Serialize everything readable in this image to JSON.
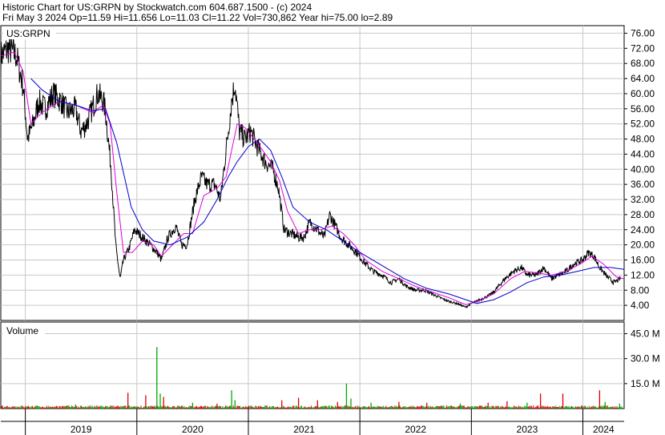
{
  "header": {
    "line1": "Historic Chart for US:GRPN by Stockwatch.com 604.687.1500 - (c) 2024",
    "line2": "Fri May  3 2024  Op=11.59  Hi=11.656  Lo=11.03  Cl=11.22  Vol=730,862  Year hi=75.00  lo=2.89"
  },
  "colors": {
    "background": "#ffffff",
    "grid": "#c8c8c8",
    "price": "#000000",
    "ma_short": "#e000e0",
    "ma_long": "#0000cc",
    "volume_up": "#00aa00",
    "volume_down": "#dd0000"
  },
  "chart_data": [
    {
      "type": "line",
      "panel_label": "US:GRPN",
      "y_ticks": [
        4,
        8,
        12,
        16,
        20,
        24,
        28,
        32,
        36,
        40,
        44,
        48,
        52,
        56,
        60,
        64,
        68,
        72,
        76
      ],
      "y_tick_labels": [
        "4.00",
        "8.00",
        "12.00",
        "16.00",
        "20.00",
        "24.00",
        "28.00",
        "32.00",
        "36.00",
        "40.00",
        "44.00",
        "48.00",
        "52.00",
        "56.00",
        "60.00",
        "64.00",
        "68.00",
        "72.00",
        "76.00"
      ],
      "ylim": [
        0,
        78
      ],
      "xlim": [
        2018.78,
        2024.37
      ],
      "x_year_labels": [
        "2019",
        "2020",
        "2021",
        "2022",
        "2023",
        "2024"
      ],
      "x_year_starts": [
        2019,
        2020,
        2021,
        2022,
        2023,
        2024
      ],
      "grid": true,
      "series": [
        {
          "name": "price",
          "points": [
            [
              2018.78,
              70
            ],
            [
              2018.85,
              72
            ],
            [
              2018.92,
              70
            ],
            [
              2018.98,
              62
            ],
            [
              2019.02,
              48
            ],
            [
              2019.07,
              52
            ],
            [
              2019.12,
              58
            ],
            [
              2019.18,
              56
            ],
            [
              2019.25,
              60
            ],
            [
              2019.32,
              58
            ],
            [
              2019.38,
              55
            ],
            [
              2019.45,
              56
            ],
            [
              2019.5,
              50
            ],
            [
              2019.55,
              52
            ],
            [
              2019.6,
              56
            ],
            [
              2019.65,
              60
            ],
            [
              2019.7,
              58
            ],
            [
              2019.72,
              55
            ],
            [
              2019.77,
              40
            ],
            [
              2019.81,
              20
            ],
            [
              2019.85,
              11
            ],
            [
              2019.88,
              16
            ],
            [
              2019.93,
              19
            ],
            [
              2019.98,
              24
            ],
            [
              2020.05,
              22
            ],
            [
              2020.12,
              20
            ],
            [
              2020.18,
              18
            ],
            [
              2020.22,
              16
            ],
            [
              2020.28,
              22
            ],
            [
              2020.35,
              25
            ],
            [
              2020.4,
              20
            ],
            [
              2020.45,
              20
            ],
            [
              2020.52,
              32
            ],
            [
              2020.58,
              38
            ],
            [
              2020.63,
              36
            ],
            [
              2020.7,
              36
            ],
            [
              2020.75,
              32
            ],
            [
              2020.8,
              45
            ],
            [
              2020.85,
              58
            ],
            [
              2020.88,
              63
            ],
            [
              2020.92,
              50
            ],
            [
              2020.97,
              48
            ],
            [
              2021.02,
              50
            ],
            [
              2021.08,
              46
            ],
            [
              2021.15,
              42
            ],
            [
              2021.22,
              40
            ],
            [
              2021.27,
              35
            ],
            [
              2021.32,
              24
            ],
            [
              2021.38,
              23
            ],
            [
              2021.45,
              22
            ],
            [
              2021.5,
              22
            ],
            [
              2021.55,
              26
            ],
            [
              2021.62,
              24
            ],
            [
              2021.68,
              22
            ],
            [
              2021.73,
              28
            ],
            [
              2021.78,
              25
            ],
            [
              2021.83,
              22
            ],
            [
              2021.9,
              20
            ],
            [
              2021.97,
              18
            ],
            [
              2022.05,
              15
            ],
            [
              2022.12,
              13
            ],
            [
              2022.2,
              12
            ],
            [
              2022.28,
              10
            ],
            [
              2022.35,
              11
            ],
            [
              2022.42,
              9
            ],
            [
              2022.5,
              8
            ],
            [
              2022.58,
              8
            ],
            [
              2022.65,
              7
            ],
            [
              2022.72,
              6
            ],
            [
              2022.8,
              5
            ],
            [
              2022.87,
              4.5
            ],
            [
              2022.95,
              3.5
            ],
            [
              2023.0,
              4.5
            ],
            [
              2023.08,
              5.5
            ],
            [
              2023.15,
              6.5
            ],
            [
              2023.2,
              7.5
            ],
            [
              2023.3,
              11
            ],
            [
              2023.38,
              13
            ],
            [
              2023.45,
              14
            ],
            [
              2023.5,
              12
            ],
            [
              2023.58,
              12
            ],
            [
              2023.65,
              14
            ],
            [
              2023.72,
              11
            ],
            [
              2023.78,
              12
            ],
            [
              2023.85,
              13
            ],
            [
              2023.92,
              15
            ],
            [
              2024.0,
              16
            ],
            [
              2024.05,
              18
            ],
            [
              2024.1,
              17
            ],
            [
              2024.15,
              14
            ],
            [
              2024.22,
              11.5
            ],
            [
              2024.28,
              10
            ],
            [
              2024.34,
              11.22
            ]
          ]
        },
        {
          "name": "ma_short",
          "points": [
            [
              2018.78,
              70
            ],
            [
              2018.9,
              71
            ],
            [
              2018.98,
              66
            ],
            [
              2019.05,
              52
            ],
            [
              2019.15,
              55
            ],
            [
              2019.3,
              58
            ],
            [
              2019.45,
              57
            ],
            [
              2019.6,
              55
            ],
            [
              2019.7,
              57
            ],
            [
              2019.76,
              52
            ],
            [
              2019.82,
              34
            ],
            [
              2019.88,
              18
            ],
            [
              2019.96,
              18
            ],
            [
              2020.05,
              21
            ],
            [
              2020.15,
              20
            ],
            [
              2020.22,
              17
            ],
            [
              2020.32,
              20
            ],
            [
              2020.42,
              23
            ],
            [
              2020.5,
              23
            ],
            [
              2020.6,
              33
            ],
            [
              2020.72,
              35
            ],
            [
              2020.8,
              38
            ],
            [
              2020.9,
              52
            ],
            [
              2020.97,
              51
            ],
            [
              2021.08,
              47
            ],
            [
              2021.2,
              42
            ],
            [
              2021.28,
              37
            ],
            [
              2021.35,
              29
            ],
            [
              2021.45,
              23
            ],
            [
              2021.55,
              24
            ],
            [
              2021.65,
              24
            ],
            [
              2021.75,
              25
            ],
            [
              2021.85,
              23
            ],
            [
              2021.95,
              20
            ],
            [
              2022.05,
              16
            ],
            [
              2022.2,
              13
            ],
            [
              2022.35,
              11
            ],
            [
              2022.5,
              9
            ],
            [
              2022.65,
              7.5
            ],
            [
              2022.8,
              6
            ],
            [
              2022.95,
              4.2
            ],
            [
              2023.05,
              5
            ],
            [
              2023.2,
              7
            ],
            [
              2023.35,
              11
            ],
            [
              2023.48,
              13
            ],
            [
              2023.6,
              12.5
            ],
            [
              2023.72,
              12
            ],
            [
              2023.85,
              13
            ],
            [
              2023.98,
              15
            ],
            [
              2024.08,
              17
            ],
            [
              2024.18,
              15
            ],
            [
              2024.3,
              11.5
            ],
            [
              2024.37,
              11
            ]
          ]
        },
        {
          "name": "ma_long",
          "points": [
            [
              2019.05,
              64
            ],
            [
              2019.15,
              61
            ],
            [
              2019.3,
              58
            ],
            [
              2019.45,
              57
            ],
            [
              2019.6,
              55.5
            ],
            [
              2019.72,
              56
            ],
            [
              2019.82,
              47
            ],
            [
              2019.95,
              30
            ],
            [
              2020.05,
              24
            ],
            [
              2020.15,
              21
            ],
            [
              2020.3,
              20
            ],
            [
              2020.45,
              22
            ],
            [
              2020.6,
              26
            ],
            [
              2020.72,
              32
            ],
            [
              2020.82,
              38
            ],
            [
              2020.9,
              42
            ],
            [
              2021.0,
              46
            ],
            [
              2021.1,
              48
            ],
            [
              2021.2,
              45
            ],
            [
              2021.3,
              38
            ],
            [
              2021.4,
              30
            ],
            [
              2021.55,
              26
            ],
            [
              2021.7,
              24
            ],
            [
              2021.85,
              21
            ],
            [
              2022.0,
              18
            ],
            [
              2022.2,
              14.5
            ],
            [
              2022.4,
              11
            ],
            [
              2022.6,
              8.5
            ],
            [
              2022.8,
              7
            ],
            [
              2022.95,
              5.5
            ],
            [
              2023.05,
              4.5
            ],
            [
              2023.2,
              5.5
            ],
            [
              2023.35,
              7.5
            ],
            [
              2023.5,
              10
            ],
            [
              2023.65,
              11.5
            ],
            [
              2023.8,
              12
            ],
            [
              2023.95,
              13
            ],
            [
              2024.1,
              14
            ],
            [
              2024.25,
              14
            ],
            [
              2024.37,
              13.5
            ]
          ]
        }
      ]
    },
    {
      "type": "bar",
      "panel_label": "Volume",
      "y_ticks": [
        15,
        30,
        45
      ],
      "y_tick_labels": [
        "15.0 M",
        "30.0 M",
        "45.0 M"
      ],
      "ylim": [
        0,
        52
      ],
      "grid": true,
      "spikes": [
        {
          "x": 2019.45,
          "v": 2.5,
          "c": "up"
        },
        {
          "x": 2019.92,
          "v": 9.5,
          "c": "down"
        },
        {
          "x": 2020.08,
          "v": 8,
          "c": "down"
        },
        {
          "x": 2020.18,
          "v": 37,
          "c": "up"
        },
        {
          "x": 2020.21,
          "v": 9,
          "c": "up"
        },
        {
          "x": 2020.24,
          "v": 7,
          "c": "down"
        },
        {
          "x": 2020.5,
          "v": 3.5,
          "c": "up"
        },
        {
          "x": 2020.72,
          "v": 3,
          "c": "down"
        },
        {
          "x": 2020.85,
          "v": 11,
          "c": "up"
        },
        {
          "x": 2020.88,
          "v": 5,
          "c": "up"
        },
        {
          "x": 2021.3,
          "v": 5,
          "c": "down"
        },
        {
          "x": 2021.45,
          "v": 6.5,
          "c": "down"
        },
        {
          "x": 2021.62,
          "v": 5,
          "c": "down"
        },
        {
          "x": 2021.8,
          "v": 4,
          "c": "down"
        },
        {
          "x": 2021.88,
          "v": 15,
          "c": "up"
        },
        {
          "x": 2021.92,
          "v": 6,
          "c": "up"
        },
        {
          "x": 2022.1,
          "v": 3.5,
          "c": "up"
        },
        {
          "x": 2022.35,
          "v": 4,
          "c": "down"
        },
        {
          "x": 2022.6,
          "v": 3.5,
          "c": "down"
        },
        {
          "x": 2022.9,
          "v": 3,
          "c": "up"
        },
        {
          "x": 2023.15,
          "v": 3.5,
          "c": "down"
        },
        {
          "x": 2023.32,
          "v": 4.5,
          "c": "down"
        },
        {
          "x": 2023.5,
          "v": 3.5,
          "c": "up"
        },
        {
          "x": 2023.62,
          "v": 9,
          "c": "down"
        },
        {
          "x": 2023.82,
          "v": 9,
          "c": "down"
        },
        {
          "x": 2024.15,
          "v": 11,
          "c": "down"
        },
        {
          "x": 2024.2,
          "v": 4,
          "c": "up"
        },
        {
          "x": 2024.33,
          "v": 3,
          "c": "up"
        }
      ]
    }
  ]
}
